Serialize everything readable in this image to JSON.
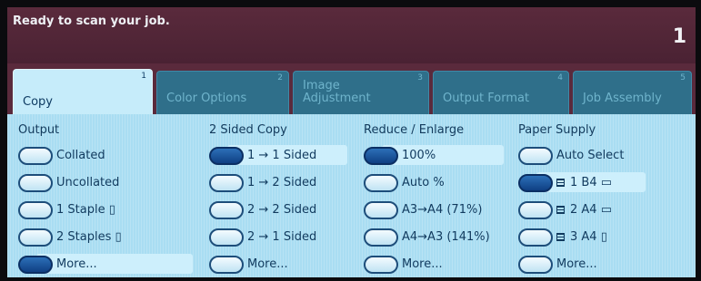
{
  "status": {
    "message": "Ready to scan your job.",
    "count": "1"
  },
  "tabs": [
    {
      "number": "1",
      "label": "Copy"
    },
    {
      "number": "2",
      "label": "Color Options"
    },
    {
      "number": "3",
      "label_line1": "Image",
      "label_line2": "Adjustment"
    },
    {
      "number": "4",
      "label": "Output Format"
    },
    {
      "number": "5",
      "label": "Job Assembly"
    }
  ],
  "columns": {
    "output": {
      "heading": "Output",
      "options": [
        "Collated",
        "Uncollated",
        "1 Staple",
        "2 Staples",
        "More..."
      ],
      "selected": "More..."
    },
    "two_sided": {
      "heading": "2 Sided Copy",
      "options": [
        "1 → 1 Sided",
        "1 → 2 Sided",
        "2 → 2 Sided",
        "2 → 1 Sided",
        "More..."
      ],
      "selected": "1 → 1 Sided"
    },
    "reduce": {
      "heading": "Reduce / Enlarge",
      "options": [
        "100%",
        "Auto %",
        "A3→A4 (71%)",
        "A4→A3 (141%)",
        "More..."
      ],
      "selected": "100%"
    },
    "paper": {
      "heading": "Paper Supply",
      "options": [
        "Auto Select",
        "1  B4",
        "2  A4",
        "3  A4",
        "More..."
      ],
      "selected": "1  B4"
    }
  }
}
